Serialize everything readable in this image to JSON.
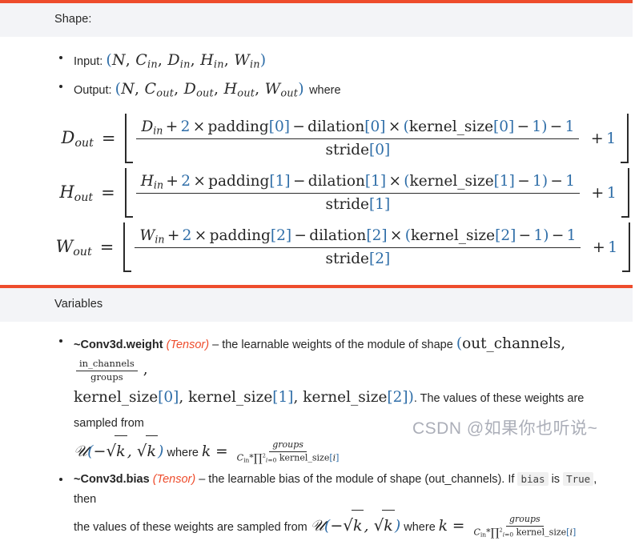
{
  "theme": {
    "accent": "#ee4c2c",
    "header_bg": "#f3f4f7",
    "text": "#262626",
    "math_blue": "#2f6ea8",
    "code_bg": "#f0f0f0"
  },
  "sections": [
    {
      "id": "shape",
      "header": "Shape:",
      "bullets": [
        {
          "label": "Input:",
          "tuple": "(N, C_in, D_in, H_in, W_in)",
          "suffix": ""
        },
        {
          "label": "Output:",
          "tuple": "(N, C_out, D_out, H_out, W_out)",
          "suffix": "where"
        }
      ],
      "equations": [
        {
          "lhs": "D_out",
          "eq": "=",
          "numerator": "D_in + 2 × padding[0] − dilation[0] × (kernel_size[0] − 1) − 1",
          "denominator": "stride[0]",
          "tail": "+ 1",
          "vars": {
            "base": "D",
            "sub": "in",
            "index": "0",
            "two": "2",
            "one": "1",
            "padding": "padding",
            "dilation": "dilation",
            "kernel_size": "kernel_size",
            "stride": "stride"
          }
        },
        {
          "lhs": "H_out",
          "eq": "=",
          "numerator": "H_in + 2 × padding[1] − dilation[1] × (kernel_size[1] − 1) − 1",
          "denominator": "stride[1]",
          "tail": "+ 1",
          "vars": {
            "base": "H",
            "sub": "in",
            "index": "1",
            "two": "2",
            "one": "1",
            "padding": "padding",
            "dilation": "dilation",
            "kernel_size": "kernel_size",
            "stride": "stride"
          }
        },
        {
          "lhs": "W_out",
          "eq": "=",
          "numerator": "W_in + 2 × padding[2] − dilation[2] × (kernel_size[2] − 1) − 1",
          "denominator": "stride[2]",
          "tail": "+ 1",
          "vars": {
            "base": "W",
            "sub": "in",
            "index": "2",
            "two": "2",
            "one": "1",
            "padding": "padding",
            "dilation": "dilation",
            "kernel_size": "kernel_size",
            "stride": "stride"
          }
        }
      ]
    },
    {
      "id": "variables",
      "header": "Variables",
      "items": [
        {
          "name": "~Conv3d.weight",
          "type": "(Tensor)",
          "desc_1": "– the learnable weights of the module of shape",
          "shape_open": "(out_channels,",
          "frac_num": "in_channels",
          "frac_den": "groups",
          "shape_comma": ",",
          "shape_rest": "kernel_size[0], kernel_size[1], kernel_size[2])",
          "desc_2": ". The values of these weights are sampled from",
          "dist": "U(−√k, √k)",
          "where": "where",
          "k_eq": "k =",
          "k_num": "groups",
          "k_den": "C_in * ∏²_{i=0} kernel_size[i]"
        },
        {
          "name": "~Conv3d.bias",
          "type": "(Tensor)",
          "desc_1": "– the learnable bias of the module of shape (out_channels). If",
          "code_1": "bias",
          "mid": "is",
          "code_2": "True",
          "desc_2": ", then",
          "desc_3": "the values of these weights are sampled from",
          "dist": "U(−√k, √k)",
          "where": "where",
          "k_eq": "k =",
          "k_num": "groups",
          "k_den": "C_in * ∏²_{i=0} kernel_size[i]"
        }
      ]
    }
  ],
  "watermark": {
    "text": "CSDN @如果你也听说~"
  },
  "symbols": {
    "N": "N",
    "C": "C",
    "D": "D",
    "H": "H",
    "W": "W",
    "in": "in",
    "out": "out",
    "U": "ᵌ",
    "sqrt": "√",
    "prod": "∏",
    "times": "×",
    "minus": "−",
    "floor_left": "⌊",
    "floor_right": "⌋"
  }
}
